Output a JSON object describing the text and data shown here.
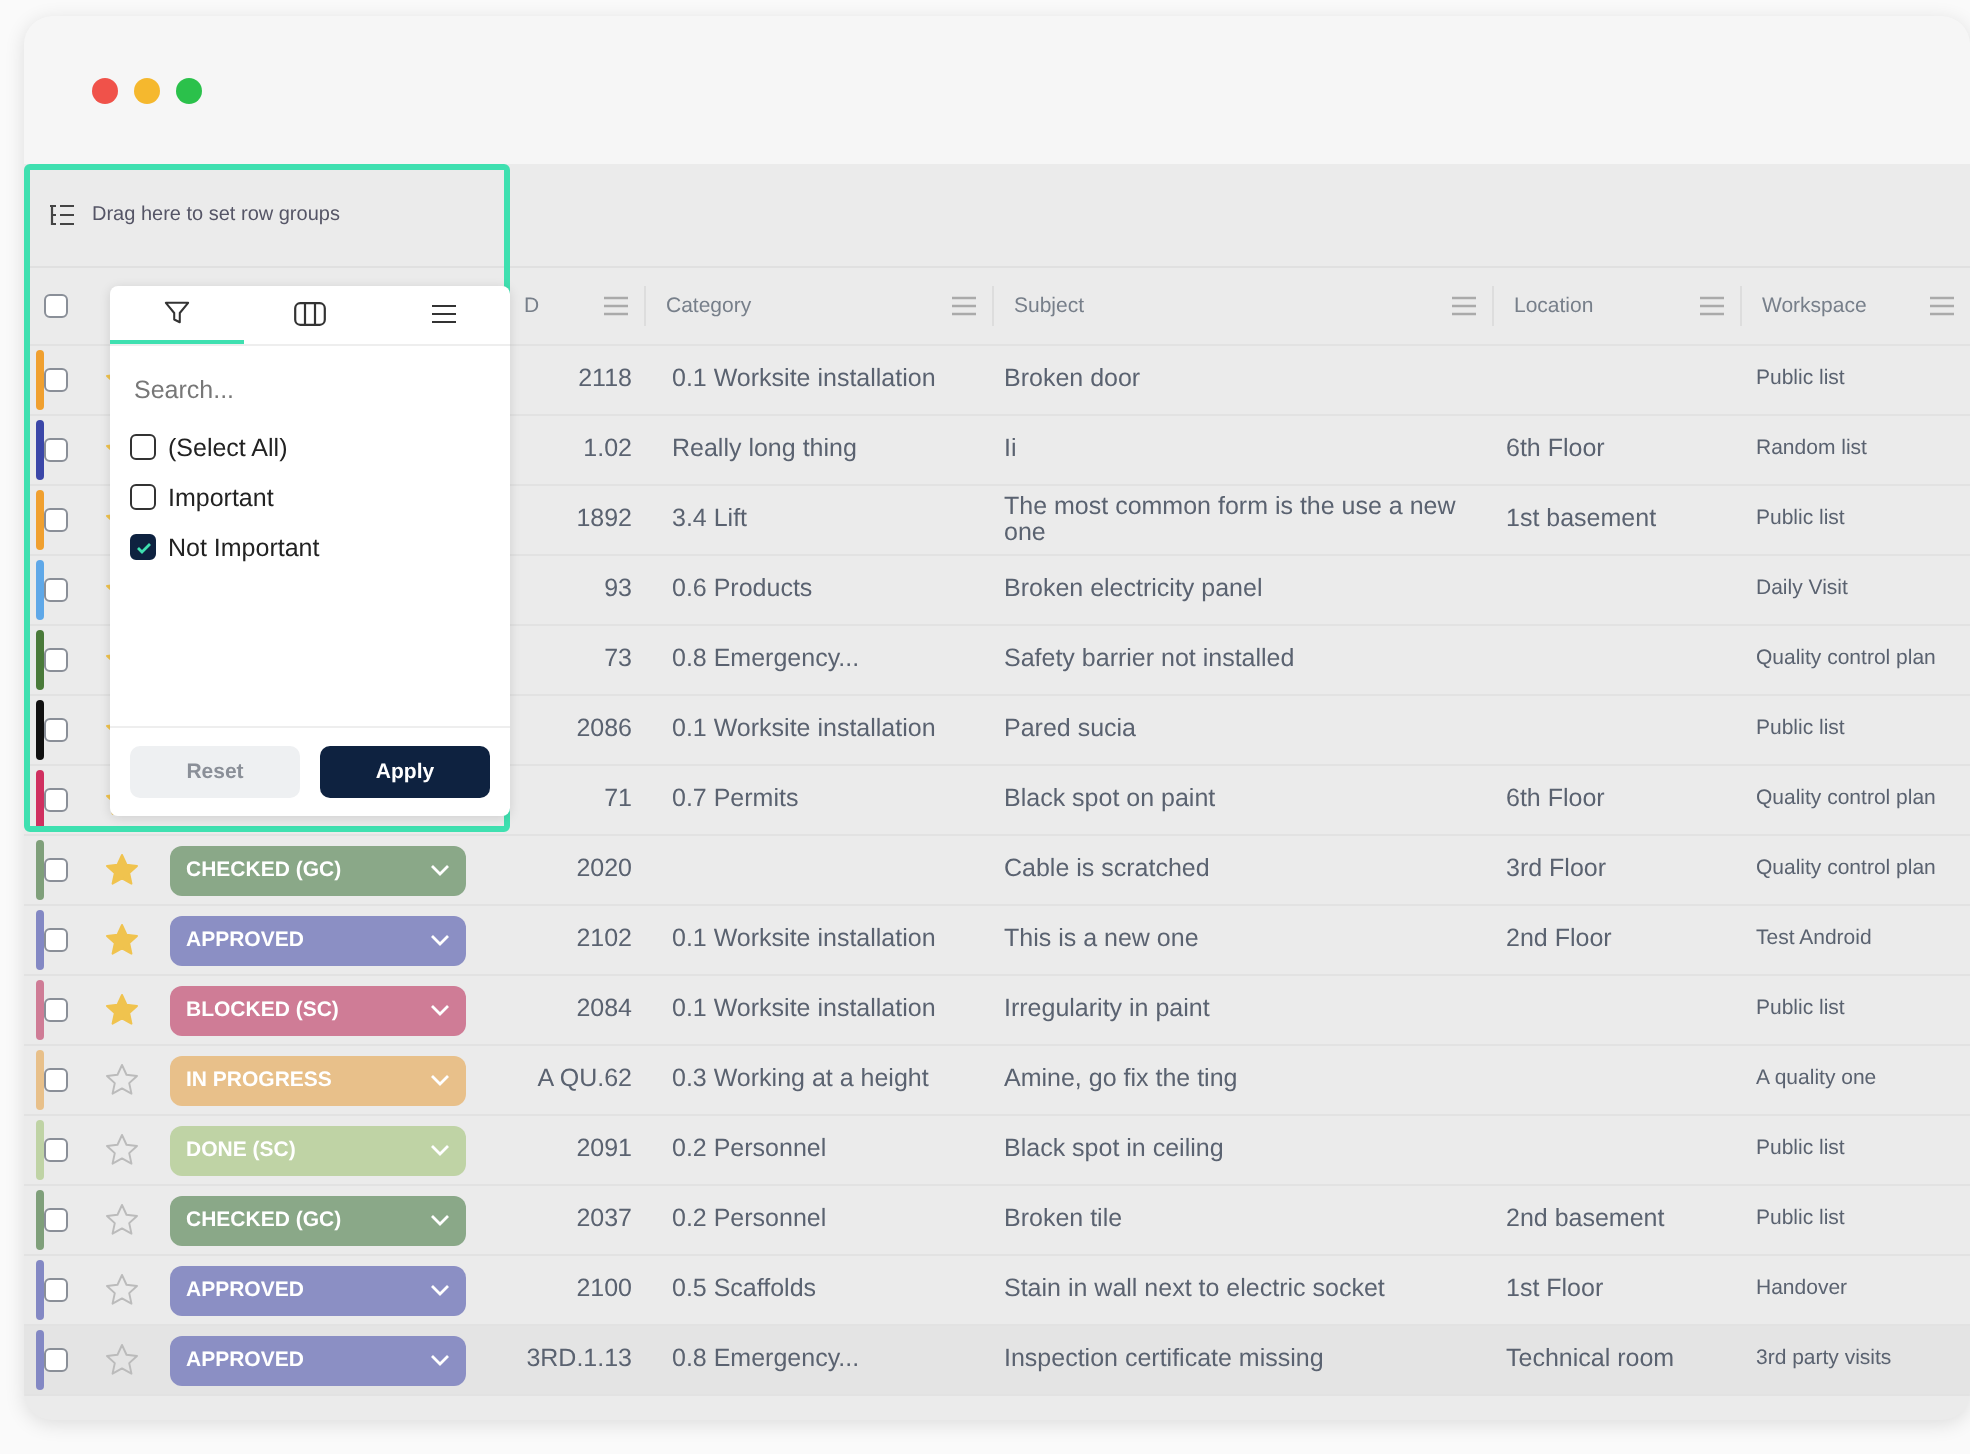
{
  "window": {
    "controls": [
      {
        "color": "#f0524a"
      },
      {
        "color": "#f5b82e"
      },
      {
        "color": "#2bc14b"
      }
    ]
  },
  "group_bar": {
    "text": "Drag here to set row groups"
  },
  "table": {
    "header_checkbox": {
      "checked": false
    },
    "columns": [
      {
        "kind": "id",
        "label": "D"
      },
      {
        "kind": "text",
        "label": "Category"
      },
      {
        "kind": "text",
        "label": "Subject"
      },
      {
        "kind": "text",
        "label": "Location"
      },
      {
        "kind": "text",
        "label": "Workspace"
      }
    ],
    "rows": [
      {
        "color": "#f0a030",
        "checked": false,
        "starred": true,
        "id": "2118",
        "category": "0.1 Worksite installation",
        "subject": "Broken door",
        "workspace": "Public list"
      },
      {
        "color": "#3b47a8",
        "checked": false,
        "starred": true,
        "id": "1.02",
        "category": "Really long thing",
        "subject": "Ii",
        "location": "6th Floor",
        "workspace": "Random list"
      },
      {
        "color": "#f0a030",
        "checked": false,
        "starred": true,
        "id": "1892",
        "category": "3.4 Lift",
        "subject": "The most common form is the use a new one",
        "location": "1st basement",
        "workspace": "Public list"
      },
      {
        "color": "#5fa8e8",
        "checked": false,
        "starred": true,
        "id": "93",
        "category": "0.6 Products",
        "subject": "Broken electricity panel",
        "workspace": "Daily Visit"
      },
      {
        "color": "#4a7a3a",
        "checked": false,
        "starred": true,
        "id": "73",
        "category": "0.8 Emergency...",
        "subject": "Safety barrier not installed",
        "workspace": "Quality control plan"
      },
      {
        "color": "#111111",
        "checked": false,
        "starred": true,
        "id": "2086",
        "category": "0.1 Worksite installation",
        "subject": "Pared sucia",
        "workspace": "Public list"
      },
      {
        "color": "#d03060",
        "checked": false,
        "starred": true,
        "id": "71",
        "category": "0.7 Permits",
        "subject": "Black spot on paint",
        "location": "6th Floor",
        "workspace": "Quality control plan"
      },
      {
        "color": "#7f9f7a",
        "checked": false,
        "starred": true,
        "status": {
          "label": "CHECKED (GC)",
          "color": "#8aa888"
        },
        "id": "2020",
        "subject": "Cable is scratched",
        "location": "3rd Floor",
        "workspace": "Quality control plan"
      },
      {
        "color": "#8388c4",
        "checked": false,
        "starred": true,
        "status": {
          "label": "APPROVED",
          "color": "#8b8fc4"
        },
        "id": "2102",
        "category": "0.1 Worksite installation",
        "subject": "This is a new one",
        "location": "2nd Floor",
        "workspace": "Test Android"
      },
      {
        "color": "#cf7c96",
        "checked": false,
        "starred": true,
        "status": {
          "label": "BLOCKED (SC)",
          "color": "#cf7c96"
        },
        "id": "2084",
        "category": "0.1 Worksite installation",
        "subject": "Irregularity in paint",
        "workspace": "Public list"
      },
      {
        "color": "#e8c08a",
        "checked": false,
        "starred": false,
        "status": {
          "label": "IN PROGRESS",
          "color": "#e8c08a"
        },
        "id": "A QU.62",
        "category": "0.3 Working at a height",
        "subject": "Amine, go fix the ting",
        "workspace": "A quality one"
      },
      {
        "color": "#bfd3a5",
        "checked": false,
        "starred": false,
        "status": {
          "label": "DONE (SC)",
          "color": "#bfd3a5"
        },
        "id": "2091",
        "category": "0.2 Personnel",
        "subject": "Black spot in ceiling",
        "workspace": "Public list"
      },
      {
        "color": "#7f9f7a",
        "checked": false,
        "starred": false,
        "status": {
          "label": "CHECKED (GC)",
          "color": "#8aa888"
        },
        "id": "2037",
        "category": "0.2 Personnel",
        "subject": "Broken tile",
        "location": "2nd basement",
        "workspace": "Public list"
      },
      {
        "color": "#8388c4",
        "starred": false,
        "status": {
          "label": "APPROVED",
          "color": "#8b8fc4"
        },
        "id": "2100",
        "checked": false,
        "category": "0.5 Scaffolds",
        "subject": "Stain in wall next to electric socket",
        "location": "1st Floor",
        "workspace": "Handover"
      },
      {
        "color": "#8388c4",
        "starred": false,
        "status": {
          "label": "APPROVED",
          "color": "#8b8fc4"
        },
        "id": "3RD.1.13",
        "checked": false,
        "category": "0.8 Emergency...",
        "subject": "Inspection certificate missing",
        "location": "Technical room",
        "workspace": "3rd party visits"
      }
    ]
  },
  "filter_popup": {
    "tabs": [
      {
        "kind": "filter",
        "selected": true
      },
      {
        "kind": "columns",
        "selected": false
      },
      {
        "kind": "menu",
        "selected": false
      }
    ],
    "search": {
      "placeholder": "Search..."
    },
    "options": [
      {
        "label": "(Select All)",
        "checked": false
      },
      {
        "label": "Important",
        "checked": false
      },
      {
        "label": "Not Important",
        "checked": true
      }
    ],
    "buttons": [
      {
        "kind": "secondary",
        "label": "Reset"
      },
      {
        "kind": "primary",
        "label": "Apply"
      }
    ]
  }
}
